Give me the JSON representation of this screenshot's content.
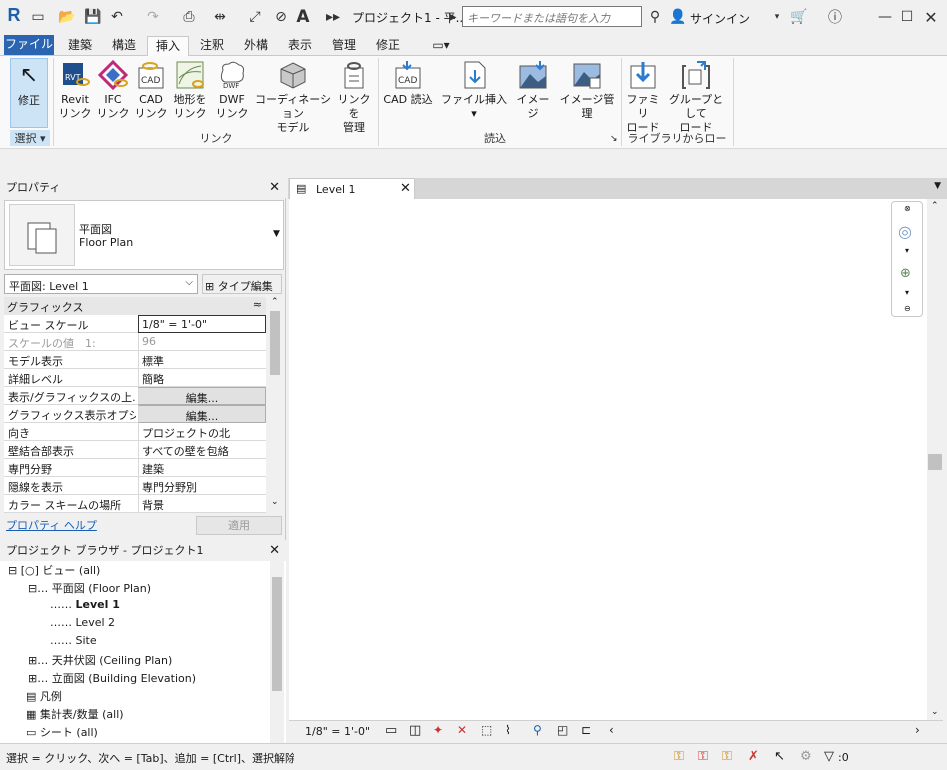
{
  "app": {
    "title": "プロジェクト1 - 平...",
    "logo": "R"
  },
  "search": {
    "placeholder": "キーワードまたは語句を入力"
  },
  "signin": "サインイン",
  "tabs": [
    "ファイル",
    "建築",
    "構造",
    "挿入",
    "注釈",
    "外構",
    "表示",
    "管理",
    "修正"
  ],
  "active_tab": "挿入",
  "ribbon": {
    "modify": "修正",
    "select": "選択",
    "buttons": [
      {
        "l1": "Revit",
        "l2": "リンク"
      },
      {
        "l1": "IFC",
        "l2": "リンク"
      },
      {
        "l1": "CAD",
        "l2": "リンク"
      },
      {
        "l1": "地形を",
        "l2": "リンク"
      },
      {
        "l1": "DWF",
        "l2": "リンク"
      },
      {
        "l1": "コーディネーション",
        "l2": "モデル"
      },
      {
        "l1": "リンクを",
        "l2": "管理"
      },
      {
        "l1": "CAD 読込",
        "l2": ""
      },
      {
        "l1": "ファイル挿入",
        "l2": "▾"
      },
      {
        "l1": "イメージ",
        "l2": ""
      },
      {
        "l1": "イメージ管理",
        "l2": ""
      },
      {
        "l1": "ファミリ",
        "l2": "ロード"
      },
      {
        "l1": "グループとして",
        "l2": "ロード"
      }
    ],
    "groups": {
      "link": "リンク",
      "import": "読込",
      "library": "ライブラリからロード"
    }
  },
  "properties": {
    "title": "プロパティ",
    "type_l1": "平面図",
    "type_l2": "Floor Plan",
    "selector": "平面図: Level 1",
    "edit_type": "タイプ編集",
    "section": "グラフィックス",
    "rows": [
      {
        "k": "ビュー スケール",
        "v": "1/8\" = 1'-0\""
      },
      {
        "k": "スケールの値　1:",
        "v": "96"
      },
      {
        "k": "モデル表示",
        "v": "標準"
      },
      {
        "k": "詳細レベル",
        "v": "簡略"
      },
      {
        "k": "表示/グラフィックスの上...",
        "v": "編集..."
      },
      {
        "k": "グラフィックス表示オプシ...",
        "v": "編集..."
      },
      {
        "k": "向き",
        "v": "プロジェクトの北"
      },
      {
        "k": "壁結合部表示",
        "v": "すべての壁を包絡"
      },
      {
        "k": "専門分野",
        "v": "建築"
      },
      {
        "k": "隠線を表示",
        "v": "専門分野別"
      },
      {
        "k": "カラー スキームの場所",
        "v": "背景"
      }
    ],
    "help": "プロパティ ヘルプ",
    "apply": "適用"
  },
  "browser": {
    "title": "プロジェクト ブラウザ - プロジェクト1",
    "items": [
      {
        "t": "ビュー (all)"
      },
      {
        "t": "平面図 (Floor Plan)"
      },
      {
        "t": "Level 1"
      },
      {
        "t": "Level 2"
      },
      {
        "t": "Site"
      },
      {
        "t": "天井伏図 (Ceiling Plan)"
      },
      {
        "t": "立面図 (Building Elevation)"
      },
      {
        "t": "凡例"
      },
      {
        "t": "集計表/数量 (all)"
      },
      {
        "t": "シート (all)"
      }
    ]
  },
  "view": {
    "tab": "Level 1",
    "scale": "1/8\" = 1'-0\""
  },
  "status": {
    "text": "選択 = クリック、次へ = [Tab]、追加 = [Ctrl]、選択解除 = [Sh",
    "filter_count": ":0"
  }
}
